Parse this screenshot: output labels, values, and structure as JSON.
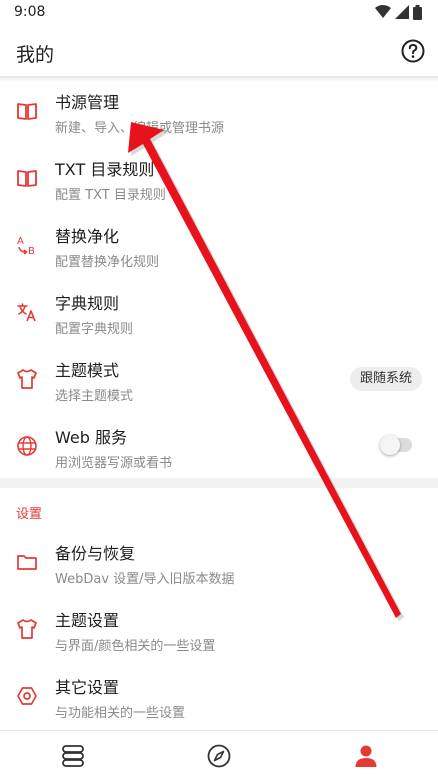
{
  "status_bar": {
    "time": "9:08"
  },
  "app_bar": {
    "title": "我的",
    "help_icon": "help-circle-icon"
  },
  "menu": [
    {
      "title": "书源管理",
      "subtitle": "新建、导入、编辑或管理书源",
      "icon": "book-icon"
    },
    {
      "title": "TXT 目录规则",
      "subtitle": "配置 TXT 目录规则",
      "icon": "book-icon"
    },
    {
      "title": "替换净化",
      "subtitle": "配置替换净化规则",
      "icon": "replace-icon"
    },
    {
      "title": "字典规则",
      "subtitle": "配置字典规则",
      "icon": "translate-icon"
    },
    {
      "title": "主题模式",
      "subtitle": "选择主题模式",
      "icon": "shirt-icon",
      "chip": "跟随系统"
    },
    {
      "title": "Web 服务",
      "subtitle": "用浏览器写源或看书",
      "icon": "globe-icon",
      "switch_on": false
    }
  ],
  "settings_section": {
    "label": "设置",
    "items": [
      {
        "title": "备份与恢复",
        "subtitle": "WebDav 设置/导入旧版本数据",
        "icon": "folder-icon"
      },
      {
        "title": "主题设置",
        "subtitle": "与界面/颜色相关的一些设置",
        "icon": "shirt-icon"
      },
      {
        "title": "其它设置",
        "subtitle": "与功能相关的一些设置",
        "icon": "settings-icon"
      }
    ]
  },
  "bottom_nav": [
    {
      "icon": "bookshelf-icon",
      "active": false
    },
    {
      "icon": "compass-icon",
      "active": false
    },
    {
      "icon": "person-icon",
      "active": true
    }
  ],
  "colors": {
    "accent": "#e53935",
    "annotation_arrow": "#e8121c"
  }
}
